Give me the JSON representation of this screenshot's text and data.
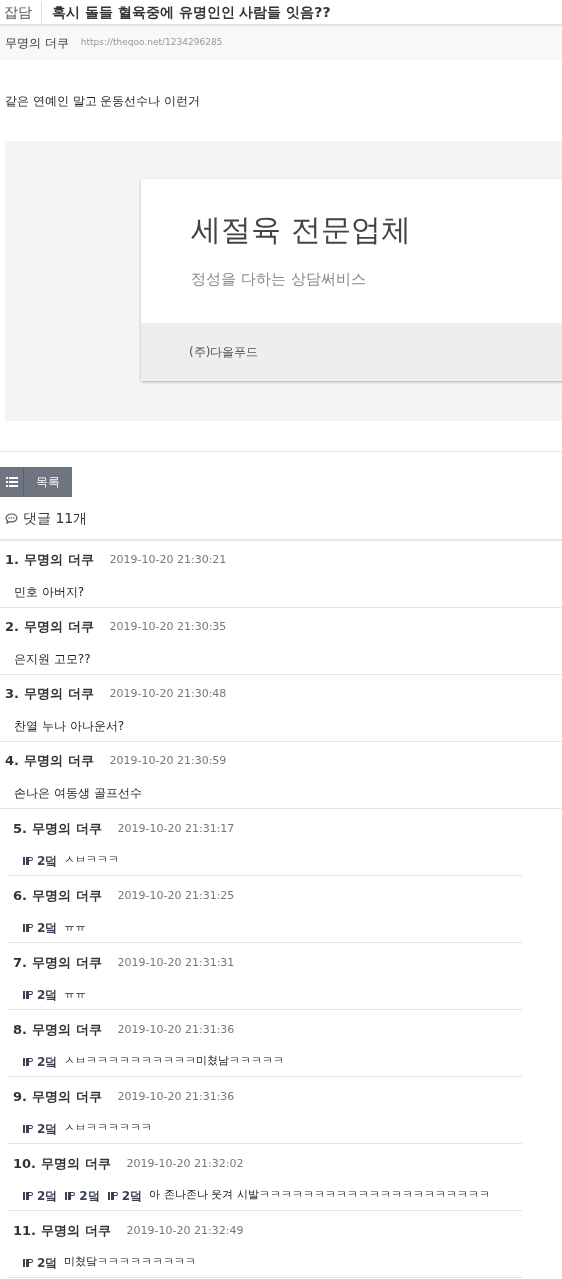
{
  "post": {
    "category": "잡담",
    "title": "혹시 돌들 혈육중에 유명인인 사람들 잇음??",
    "author": "무명의 더쿠",
    "url": "https://theqoo.net/1234296285",
    "body": "같은 연예인 말고 운동선수나 이런거"
  },
  "ad": {
    "headline": "세절육 전문업체",
    "tagline": "정성을 다하는 상담써비스",
    "company": "(주)다올푸드"
  },
  "list_button": {
    "label": "목록"
  },
  "comments_header": {
    "label": "댓글 11개"
  },
  "comments": [
    {
      "kind": "comment",
      "number": "1.",
      "author": "무명의 더쿠",
      "time": "2019-10-20 21:30:21",
      "text": "민호 아버지?"
    },
    {
      "kind": "comment",
      "number": "2.",
      "author": "무명의 더쿠",
      "time": "2019-10-20 21:30:35",
      "text": "은지원 고모??"
    },
    {
      "kind": "comment",
      "number": "3.",
      "author": "무명의 더쿠",
      "time": "2019-10-20 21:30:48",
      "text": "찬열 누나 아나운서?"
    },
    {
      "kind": "comment",
      "number": "4.",
      "author": "무명의 더쿠",
      "time": "2019-10-20 21:30:59",
      "text": "손나은 여동생 골프선수"
    },
    {
      "kind": "reply",
      "number": "5.",
      "author": "무명의 더쿠",
      "time": "2019-10-20 21:31:17",
      "mentions": [
        "2덬"
      ],
      "text": "ㅅㅂㅋㅋㅋ"
    },
    {
      "kind": "reply",
      "number": "6.",
      "author": "무명의 더쿠",
      "time": "2019-10-20 21:31:25",
      "mentions": [
        "2덬"
      ],
      "text": "ㅠㅠ"
    },
    {
      "kind": "reply",
      "number": "7.",
      "author": "무명의 더쿠",
      "time": "2019-10-20 21:31:31",
      "mentions": [
        "2덬"
      ],
      "text": "ㅠㅠ"
    },
    {
      "kind": "reply",
      "number": "8.",
      "author": "무명의 더쿠",
      "time": "2019-10-20 21:31:36",
      "mentions": [
        "2덬"
      ],
      "text": "ㅅㅂㅋㅋㅋㅋㅋㅋㅋㅋㅋㅋ미쳤남ㅋㅋㅋㅋㅋ"
    },
    {
      "kind": "reply",
      "number": "9.",
      "author": "무명의 더쿠",
      "time": "2019-10-20 21:31:36",
      "mentions": [
        "2덬"
      ],
      "text": "ㅅㅂㅋㅋㅋㅋㅋㅋ"
    },
    {
      "kind": "reply",
      "number": "10.",
      "author": "무명의 더쿠",
      "time": "2019-10-20 21:32:02",
      "mentions": [
        "2덬",
        "2덬",
        "2덬"
      ],
      "text": "아 존나존나 웃겨 시발ㅋㅋㅋㅋㅋㅋㅋㅋㅋㅋㅋㅋㅋㅋㅋㅋㅋㅋㅋㅋㅋ"
    },
    {
      "kind": "reply",
      "number": "11.",
      "author": "무명의 더쿠",
      "time": "2019-10-20 21:32:49",
      "mentions": [
        "2덬"
      ],
      "text": "미쳤닼ㅋㅋㅋㅋㅋㅋㅋㅋㅋ"
    }
  ]
}
